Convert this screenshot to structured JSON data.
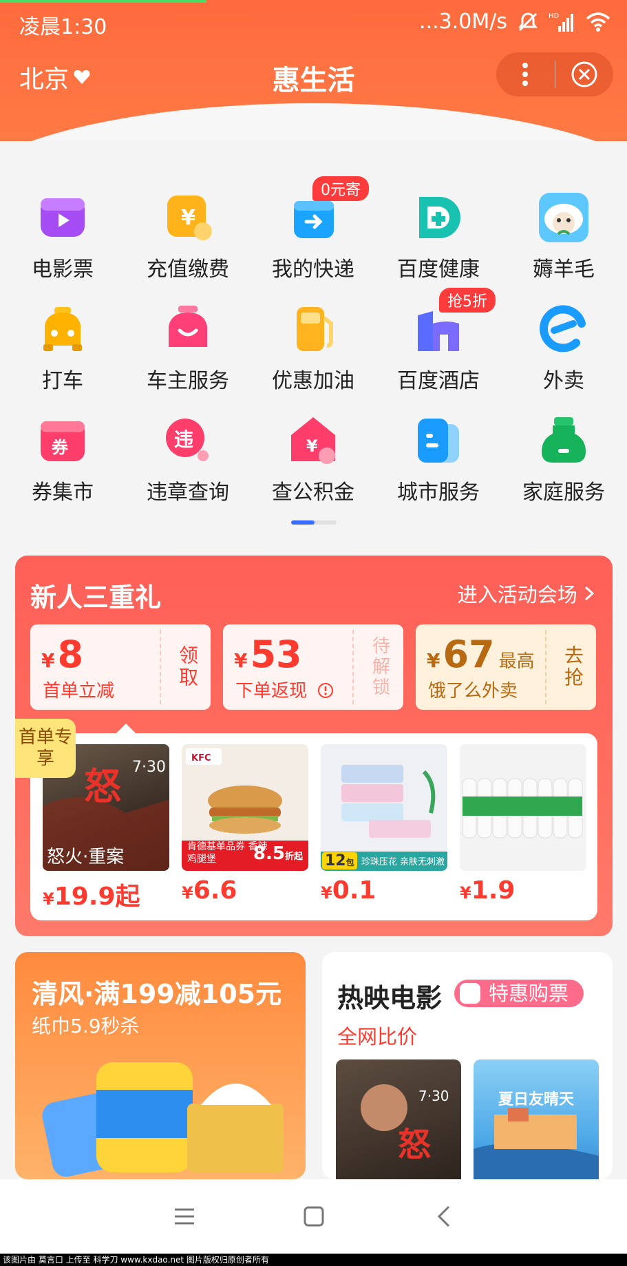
{
  "status_bar": {
    "time": "凌晨1:30",
    "network_speed": "...3.0M/s",
    "hd": "HD"
  },
  "navbar": {
    "city": "北京",
    "title": "惠生活",
    "more_icon": "more-dots-icon",
    "close_icon": "close-circle-icon"
  },
  "services": [
    {
      "label": "电影票",
      "icon": "movie-ticket-icon",
      "tag": ""
    },
    {
      "label": "充值缴费",
      "icon": "recharge-yen-icon",
      "tag": ""
    },
    {
      "label": "我的快递",
      "icon": "express-box-icon",
      "tag": "0元寄"
    },
    {
      "label": "百度健康",
      "icon": "health-cross-icon",
      "tag": ""
    },
    {
      "label": "薅羊毛",
      "icon": "sheep-icon",
      "tag": ""
    },
    {
      "label": "打车",
      "icon": "taxi-icon",
      "tag": ""
    },
    {
      "label": "车主服务",
      "icon": "car-owner-icon",
      "tag": ""
    },
    {
      "label": "优惠加油",
      "icon": "fuel-pump-icon",
      "tag": ""
    },
    {
      "label": "百度酒店",
      "icon": "hotel-icon",
      "tag": "抢5折"
    },
    {
      "label": "外卖",
      "icon": "takeout-e-icon",
      "tag": ""
    },
    {
      "label": "券集市",
      "icon": "coupon-icon",
      "tag": ""
    },
    {
      "label": "违章查询",
      "icon": "violation-search-icon",
      "tag": ""
    },
    {
      "label": "查公积金",
      "icon": "housing-fund-icon",
      "tag": ""
    },
    {
      "label": "城市服务",
      "icon": "city-service-icon",
      "tag": ""
    },
    {
      "label": "家庭服务",
      "icon": "home-service-icon",
      "tag": ""
    }
  ],
  "promo": {
    "title": "新人三重礼",
    "link": "进入活动会场",
    "coupons": [
      {
        "yen": "¥",
        "amount": "8",
        "suffix": "",
        "desc": "首单立减",
        "action": "领取"
      },
      {
        "yen": "¥",
        "amount": "53",
        "suffix": "",
        "desc": "下单返现",
        "action": "待解锁"
      },
      {
        "yen": "¥",
        "amount": "67",
        "suffix": "最高",
        "desc": "饿了么外卖",
        "action": "去抢"
      }
    ],
    "first_order_badge": "首单专享",
    "products": [
      {
        "caption": "怒火·重案",
        "yen": "¥",
        "price": "19.9起",
        "image": "movie-poster-angry"
      },
      {
        "caption": "肯德基单品券 香辣鸡腿堡",
        "discount": "8.5",
        "discount_unit": "折起",
        "brand": "KFC",
        "yen": "¥",
        "price": "6.6",
        "image": "kfc-burger"
      },
      {
        "caption": "珍珠压花 亲肤无刺激",
        "count": "12",
        "count_unit": "包",
        "yen": "¥",
        "price": "0.1",
        "image": "tissue-packs"
      },
      {
        "caption": "",
        "yen": "¥",
        "price": "1.9",
        "image": "ad-calcium-milk"
      }
    ]
  },
  "card_left": {
    "title": "清风·满199减105元",
    "subtitle": "纸巾5.9秒杀"
  },
  "card_right": {
    "title": "热映电影",
    "pill": "特惠购票",
    "subtitle": "全网比价",
    "poster_1": "怒火·重案",
    "poster_2": "夏日友晴天"
  },
  "bottom_nav": {
    "menu": "menu-lines-icon",
    "home": "home-square-icon",
    "back": "back-chevron-icon"
  },
  "footer": "该图片由 莫言口 上传至 科学刀 www.kxdao.net 图片版权归原创者所有",
  "colors": {
    "brand_orange": "#ff6a3d",
    "promo_red": "#ff5f57",
    "price_red": "#ff3b30",
    "pager_active": "#3b6bff"
  }
}
